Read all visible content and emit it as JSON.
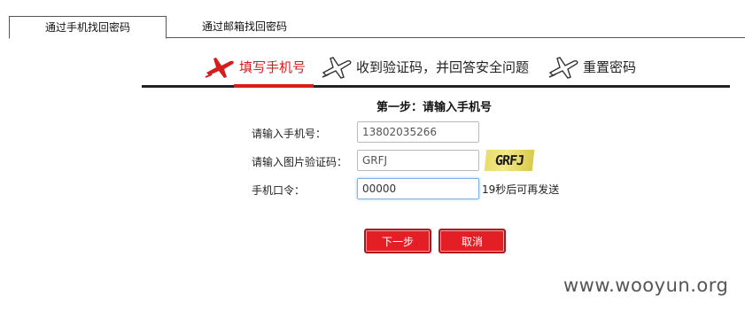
{
  "tabs": [
    {
      "label": "通过手机找回密码",
      "active": true
    },
    {
      "label": "通过邮箱找回密码",
      "active": false
    }
  ],
  "steps": [
    {
      "label": "填写手机号",
      "icon": "airplane-icon",
      "active": true
    },
    {
      "label": "收到验证码，并回答安全问题",
      "icon": "airplane-icon",
      "active": false
    },
    {
      "label": "重置密码",
      "icon": "airplane-icon",
      "active": false
    }
  ],
  "form": {
    "title": "第一步：请输入手机号",
    "phone_label": "请输入手机号：",
    "phone_value": "13802035266",
    "captcha_label": "请输入图片验证码：",
    "captcha_value": "GRFJ",
    "captcha_image_text": "GRFJ",
    "token_label": "手机口令：",
    "token_value": "00000",
    "countdown": "19秒后可再发送"
  },
  "buttons": {
    "next": "下一步",
    "cancel": "取消"
  },
  "watermark": "www.wooyun.org",
  "colors": {
    "accent": "#d41e1e",
    "button": "#e31e24",
    "captcha_bg": "#f0e27a"
  }
}
